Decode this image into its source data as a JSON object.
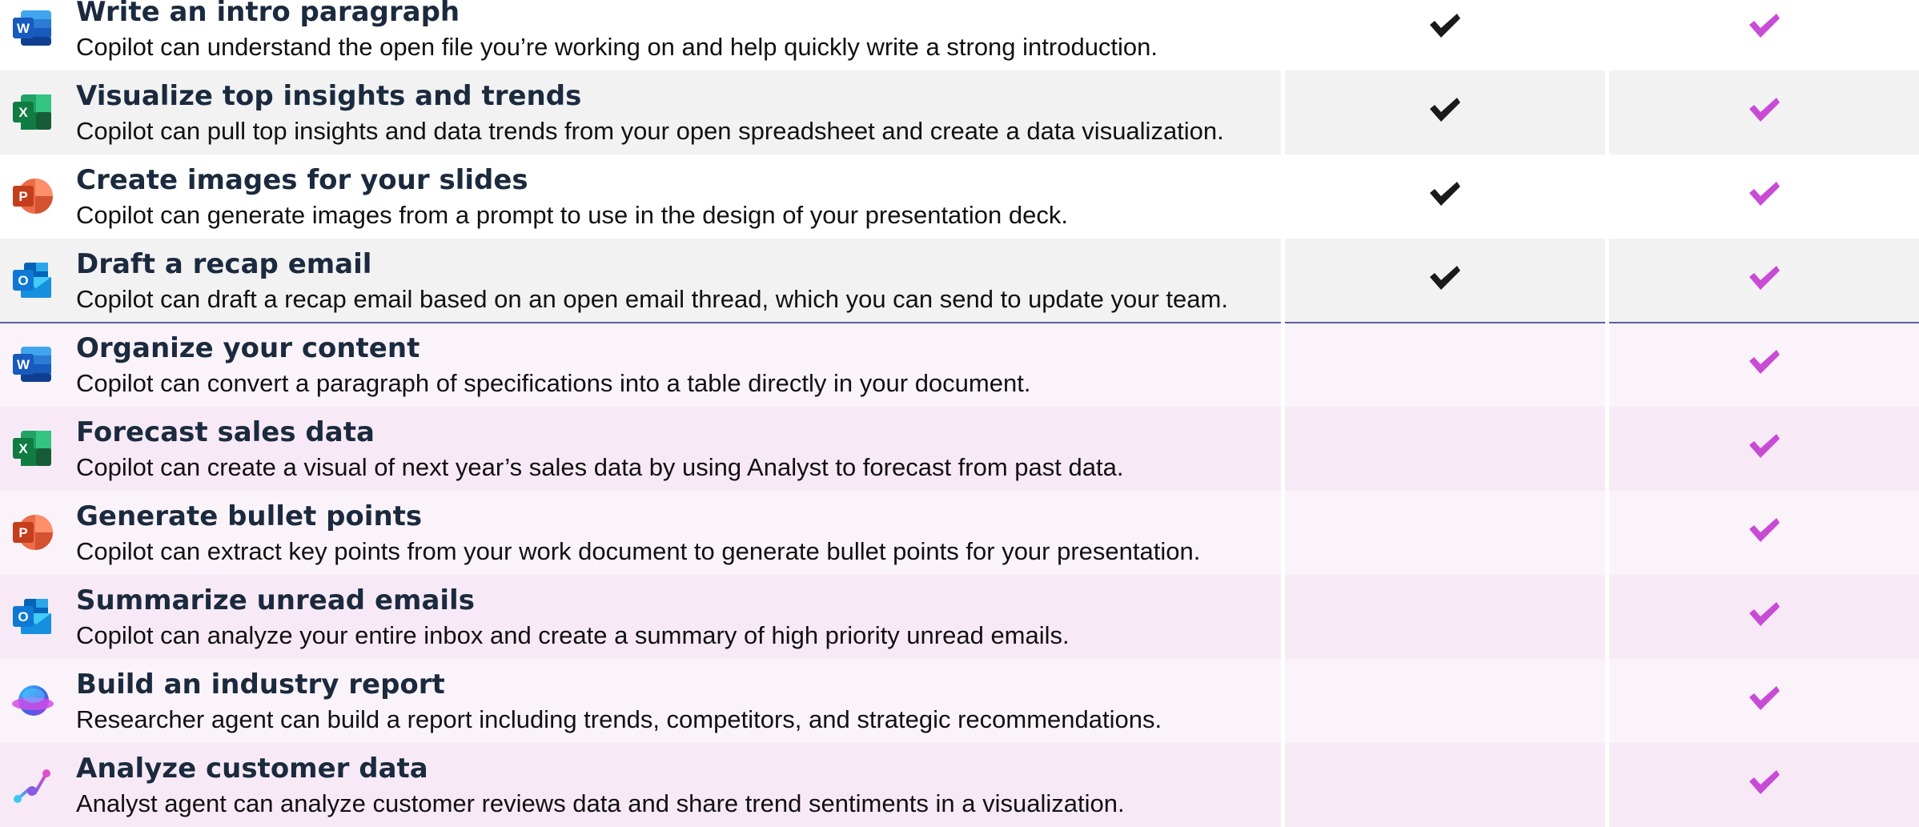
{
  "colors": {
    "white_row": "#ffffff",
    "gray_row": "#f2f2f2",
    "pink_row_light": "#fbf3fa",
    "pink_row": "#f7eaf6",
    "check_dark": "#1a1a1a",
    "check_magenta": "#c84bd6",
    "divider": "#5b5ea6"
  },
  "rows": [
    {
      "app": "word-icon",
      "badge": "W",
      "title": "Write an intro paragraph",
      "desc": "Copilot can understand the open file you’re working on and help quickly write a strong introduction.",
      "col2": true,
      "col3": true
    },
    {
      "app": "excel-icon",
      "badge": "X",
      "title": "Visualize top insights and trends",
      "desc": "Copilot can pull top insights and data trends from your open spreadsheet and create a data visualization.",
      "col2": true,
      "col3": true
    },
    {
      "app": "powerpoint-icon",
      "badge": "P",
      "title": "Create images for your slides",
      "desc": "Copilot can generate images from a prompt to use in the design of your presentation deck.",
      "col2": true,
      "col3": true
    },
    {
      "app": "outlook-icon",
      "badge": "O",
      "title": "Draft a recap email",
      "desc": "Copilot can draft a recap email based on an open email thread, which you can send to update your team.",
      "col2": true,
      "col3": true
    },
    {
      "app": "word-icon",
      "badge": "W",
      "title": "Organize your content",
      "desc": "Copilot can convert a paragraph of specifications into a table directly in your document.",
      "col2": false,
      "col3": true
    },
    {
      "app": "excel-icon",
      "badge": "X",
      "title": "Forecast sales data",
      "desc": "Copilot can create a visual of next year’s sales data by using Analyst to forecast from past data.",
      "col2": false,
      "col3": true
    },
    {
      "app": "powerpoint-icon",
      "badge": "P",
      "title": "Generate bullet points",
      "desc": "Copilot can extract key points from your work document to generate bullet points for your presentation.",
      "col2": false,
      "col3": true
    },
    {
      "app": "outlook-icon",
      "badge": "O",
      "title": "Summarize unread emails",
      "desc": "Copilot can analyze your entire inbox and create a summary of high priority unread emails.",
      "col2": false,
      "col3": true
    },
    {
      "app": "researcher-agent-icon",
      "badge": "",
      "title": "Build an industry report",
      "desc": "Researcher agent can build a report including trends, competitors, and strategic recommendations.",
      "col2": false,
      "col3": true
    },
    {
      "app": "analyst-agent-icon",
      "badge": "",
      "title": "Analyze customer data",
      "desc": "Analyst agent can analyze customer reviews data and share trend sentiments in a visualization.",
      "col2": false,
      "col3": true
    }
  ]
}
